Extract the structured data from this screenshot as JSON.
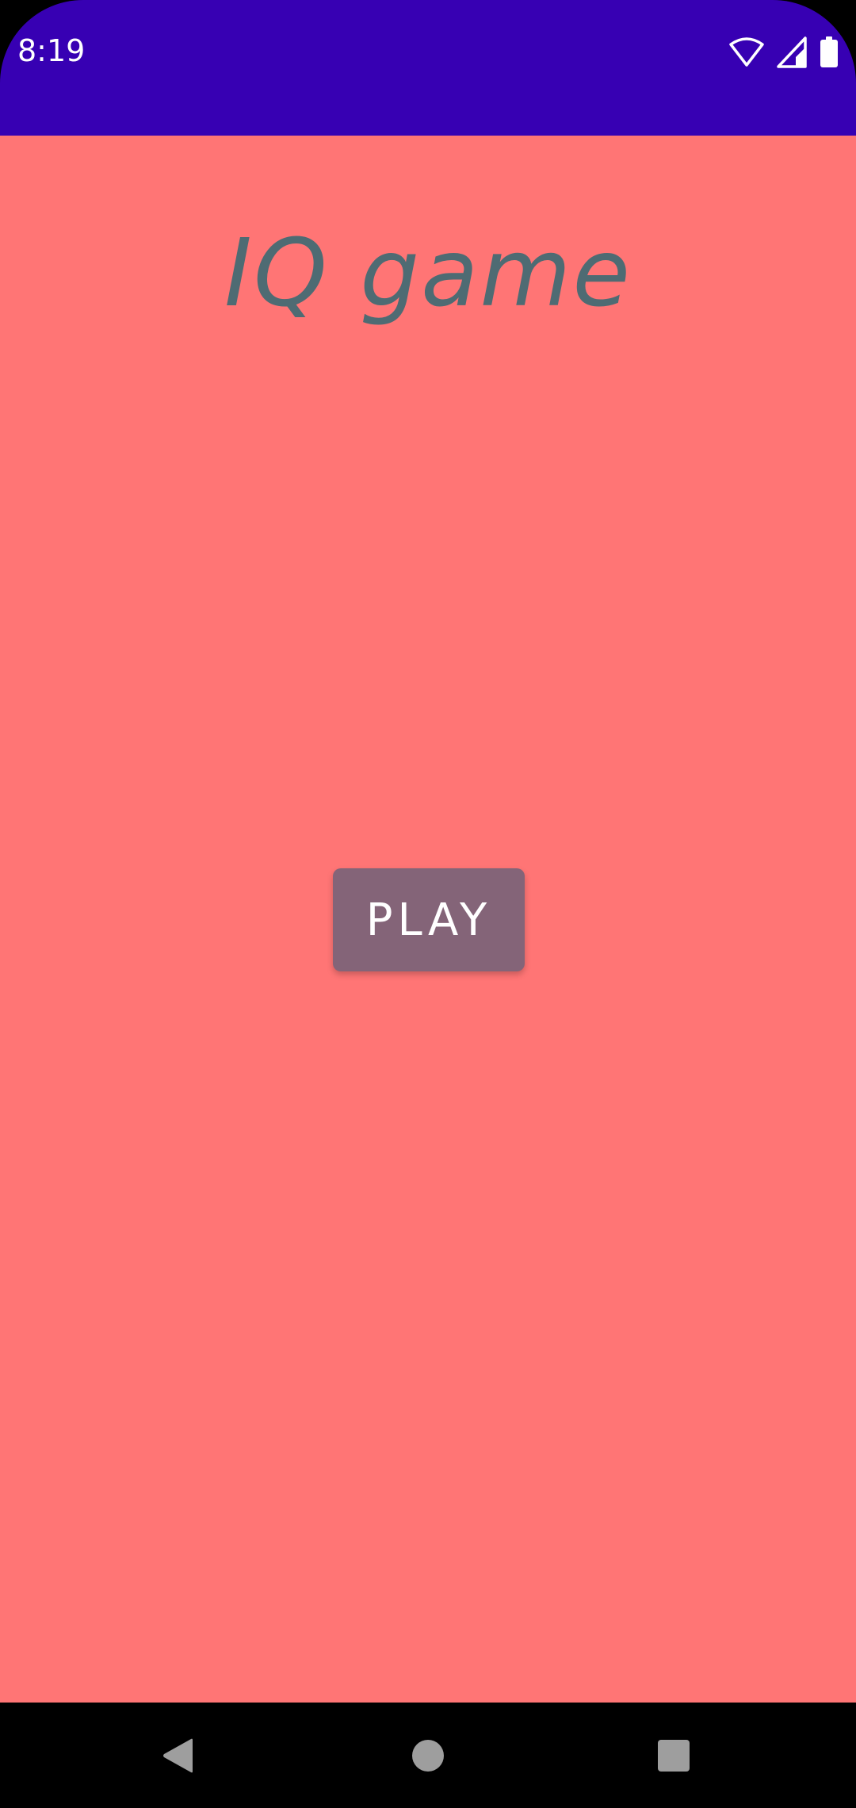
{
  "status_bar": {
    "time": "8:19",
    "background_color": "#3700B3",
    "icons": [
      "wifi-icon",
      "cellular-signal-icon",
      "battery-icon"
    ]
  },
  "main": {
    "title": "IQ game",
    "play_button_label": "PLAY",
    "background_color": "#FF7575",
    "title_color": "#4E6B73",
    "button_color": "#846478"
  },
  "nav_bar": {
    "buttons": [
      "back-icon",
      "home-icon",
      "recents-icon"
    ]
  }
}
